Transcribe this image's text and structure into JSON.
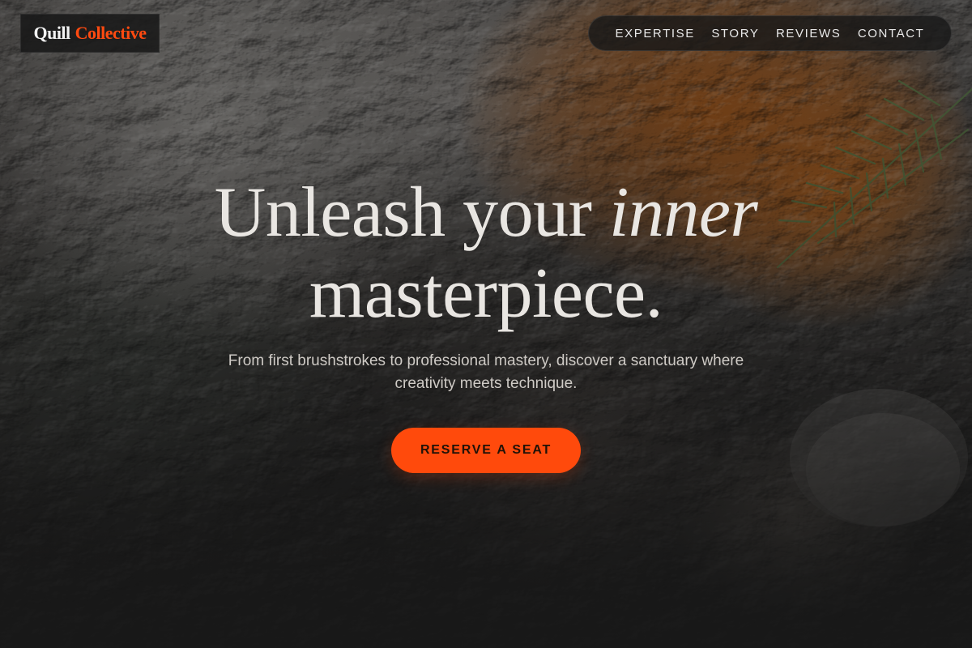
{
  "brand": {
    "name_part1": "Quill",
    "name_part2": "Collective",
    "accent_color": "#ff4a0c"
  },
  "nav": {
    "items": [
      {
        "label": "EXPERTISE"
      },
      {
        "label": "STORY"
      },
      {
        "label": "REVIEWS"
      },
      {
        "label": "CONTACT"
      }
    ]
  },
  "hero": {
    "headline_part1": "Unleash your",
    "headline_emphasis": "inner",
    "headline_part2": "masterpiece.",
    "subtitle": "From first brushstrokes to professional mastery, discover a sanctuary where creativity meets technique.",
    "cta_label": "RESERVE A SEAT",
    "background_image": "textured-oil-paint-palette-with-rosemary"
  }
}
